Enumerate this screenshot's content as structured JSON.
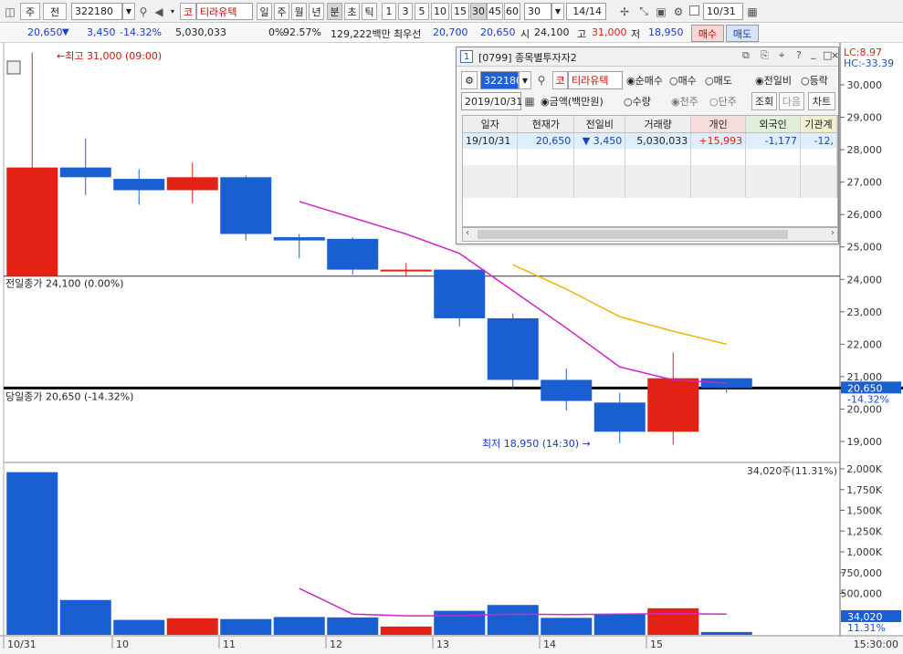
{
  "toolbar": {
    "mode": "주",
    "prev": "전",
    "code": "322180",
    "stock_name": "티라유텍",
    "stock_type": "코",
    "periods": [
      "일",
      "주",
      "월",
      "년",
      "분",
      "초",
      "틱"
    ],
    "period_active": "분",
    "intervals": [
      "1",
      "3",
      "5",
      "10",
      "15",
      "30",
      "45",
      "60"
    ],
    "interval_active": "30",
    "interval_select": "30",
    "count": "14/14",
    "date": "10/31"
  },
  "info": {
    "price": "20,650",
    "change": "3,450",
    "change_pct": "-14.32%",
    "volume": "5,030,033",
    "ratio": "0%",
    "ratio2": "92.57%",
    "amount": "129,222백만",
    "best_label": "최우선",
    "best_ask": "20,700",
    "best_bid": "20,650",
    "open_label": "시",
    "open": "24,100",
    "high_label": "고",
    "high": "31,000",
    "low_label": "저",
    "low": "18,950",
    "buy": "매수",
    "sell": "매도"
  },
  "chart_data": {
    "type": "candlestick",
    "x_labels": [
      "10/31",
      "10",
      "11",
      "12",
      "13",
      "14",
      "15"
    ],
    "candles": [
      {
        "o": 24100,
        "c": 27450,
        "h": 31000,
        "l": 24100
      },
      {
        "o": 27450,
        "c": 27150,
        "h": 28350,
        "l": 26600
      },
      {
        "o": 27100,
        "c": 26750,
        "h": 27400,
        "l": 26300
      },
      {
        "o": 26750,
        "c": 27150,
        "h": 27600,
        "l": 26350
      },
      {
        "o": 27150,
        "c": 25400,
        "h": 27200,
        "l": 25200
      },
      {
        "o": 25300,
        "c": 25200,
        "h": 25400,
        "l": 24650
      },
      {
        "o": 25250,
        "c": 24300,
        "h": 25300,
        "l": 24150
      },
      {
        "o": 24250,
        "c": 24300,
        "h": 24500,
        "l": 24100
      },
      {
        "o": 24300,
        "c": 22800,
        "h": 24300,
        "l": 22550
      },
      {
        "o": 22800,
        "c": 20900,
        "h": 22950,
        "l": 20600
      },
      {
        "o": 20900,
        "c": 20250,
        "h": 21250,
        "l": 19950
      },
      {
        "o": 20200,
        "c": 19300,
        "h": 20500,
        "l": 18950
      },
      {
        "o": 19300,
        "c": 20950,
        "h": 21750,
        "l": 18900
      },
      {
        "o": 20950,
        "c": 20650,
        "h": 20900,
        "l": 20500
      }
    ],
    "ma_short": [
      null,
      null,
      null,
      null,
      null,
      26400,
      25900,
      25400,
      24800,
      23650,
      22500,
      21300,
      20900,
      20800
    ],
    "ma_long": [
      null,
      null,
      null,
      null,
      null,
      null,
      null,
      null,
      null,
      24450,
      23700,
      22850,
      22400,
      22000
    ],
    "volumes": [
      1960000,
      420000,
      180000,
      200000,
      190000,
      215000,
      210000,
      100000,
      290000,
      360000,
      205000,
      250000,
      320000,
      34020
    ],
    "volume_ma": [
      null,
      null,
      null,
      null,
      null,
      560000,
      250000,
      230000,
      230000,
      250000,
      245000,
      250000,
      255000,
      250000
    ],
    "price_axis": [
      "30,000",
      "29,000",
      "28,000",
      "27,000",
      "26,000",
      "25,000",
      "24,000",
      "23,000",
      "22,000",
      "21,000",
      "20,000",
      "19,000"
    ],
    "volume_axis": [
      "2,000K",
      "1,750K",
      "1,500K",
      "1,250K",
      "1,000K",
      "750,000",
      "500,000"
    ],
    "ylim_price": [
      18700,
      31450
    ],
    "ylim_volume": [
      0,
      2000000
    ],
    "high_label": "←최고 31,000 (09:00)",
    "low_label": "최저 18,950 (14:30) →",
    "prev_close_label": "전일종가 24,100 (0.00%)",
    "today_close_label": "당일종가 20,650 (-14.32%)",
    "lc_label": "LC:8.97",
    "hc_label": "HC:-33.39",
    "last_price_tag": "20,650",
    "last_pct_tag": "-14.32%",
    "vol_annot": "34,020주(11.31%)",
    "vol_tag": "34,020",
    "vol_pct_tag": "11.31%",
    "time_label": "15:30:00",
    "colors": {
      "up": "#e32114",
      "down": "#1a5fd2",
      "ma_short": "#d026c8",
      "ma_long": "#f0b400"
    }
  },
  "popup": {
    "title": "[0799] 종목별투자자2",
    "badge": "1",
    "code": "322180",
    "stock_type": "코",
    "stock_name": "티라유텍",
    "radios1": [
      "순매수",
      "매수",
      "매도"
    ],
    "radios2": [
      "전일비",
      "등락"
    ],
    "date": "2019/10/31",
    "radios3": [
      "금액(백만원)",
      "수량"
    ],
    "radios4": [
      "천주",
      "단주"
    ],
    "btn_query": "조회",
    "btn_next": "다음",
    "btn_chart": "차트",
    "columns": [
      "일자",
      "현재가",
      "전일비",
      "거래량",
      "개인",
      "외국인",
      "기관계"
    ],
    "rows": [
      {
        "date": "19/10/31",
        "price": "20,650",
        "arrow": "▼",
        "diff": "3,450",
        "volume": "5,030,033",
        "indiv": "+15,993",
        "foreign": "-1,177",
        "inst": "-12,"
      }
    ]
  }
}
